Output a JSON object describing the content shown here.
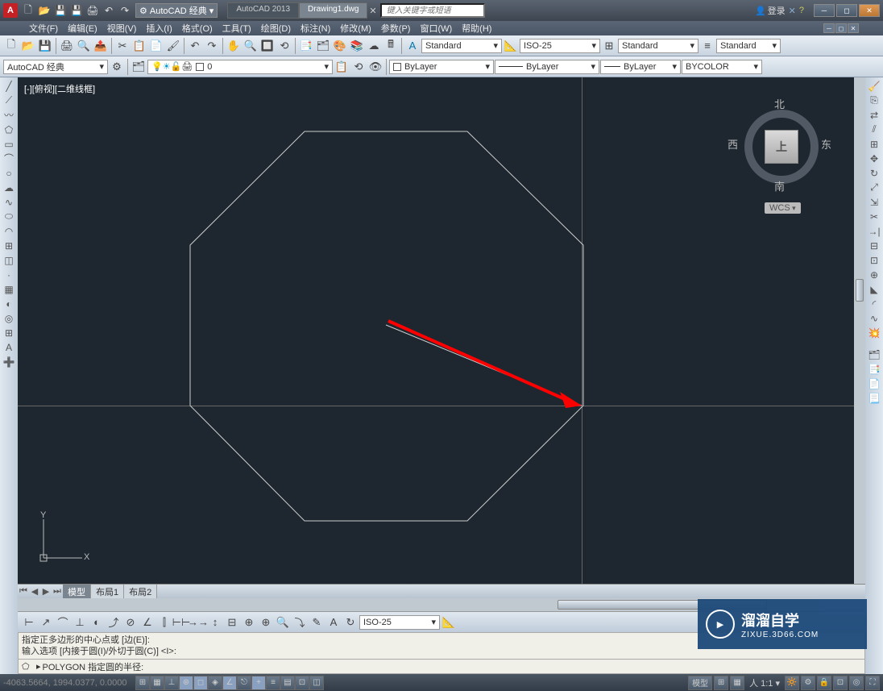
{
  "title": {
    "app": "AutoCAD 2013",
    "file": "Drawing1.dwg"
  },
  "workspace": "AutoCAD 经典",
  "search_placeholder": "键入关键字或短语",
  "login": "登录",
  "menu": [
    "文件(F)",
    "编辑(E)",
    "视图(V)",
    "插入(I)",
    "格式(O)",
    "工具(T)",
    "绘图(D)",
    "标注(N)",
    "修改(M)",
    "参数(P)",
    "窗口(W)",
    "帮助(H)"
  ],
  "styles": {
    "text": "Standard",
    "dim": "ISO-25",
    "table": "Standard",
    "ml": "Standard"
  },
  "layer": {
    "name": "0"
  },
  "props": {
    "color": "ByLayer",
    "ltype": "ByLayer",
    "lweight": "ByLayer",
    "plot": "BYCOLOR"
  },
  "viewlabel": "[-][俯视][二维线框]",
  "viewcube": {
    "top": "上",
    "north": "北",
    "south": "南",
    "east": "东",
    "west": "西",
    "wcs": "WCS"
  },
  "ucs": {
    "x": "X",
    "y": "Y"
  },
  "tabs": [
    "模型",
    "布局1",
    "布局2"
  ],
  "bottom_dim": "ISO-25",
  "cmd": {
    "l1": "指定正多边形的中心点或 [边(E)]:",
    "l2": "输入选项 [内接于圆(I)/外切于圆(C)] <I>:",
    "l3": "POLYGON 指定圆的半径:"
  },
  "status": {
    "coords": "-4063.5664, 1994.0377, 0.0000",
    "model": "模型",
    "scale": "人 1:1 ▾"
  },
  "watermark": {
    "name": "溜溜自学",
    "url": "ZIXUE.3D66.COM"
  }
}
